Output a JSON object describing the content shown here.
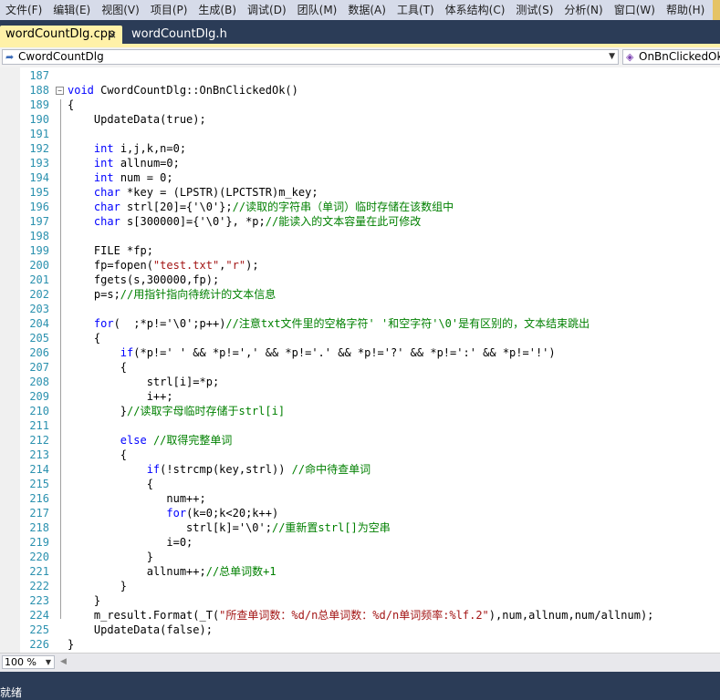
{
  "menu": [
    "文件(F)",
    "编辑(E)",
    "视图(V)",
    "项目(P)",
    "生成(B)",
    "调试(D)",
    "团队(M)",
    "数据(A)",
    "工具(T)",
    "体系结构(C)",
    "测试(S)",
    "分析(N)",
    "窗口(W)",
    "帮助(H)"
  ],
  "tabs": {
    "active": "wordCountDlg.cpp",
    "active_close": "×",
    "inactive": "wordCountDlg.h"
  },
  "nav": {
    "class_icon": "class-icon",
    "class_name": "CwordCountDlg",
    "member_name": "OnBnClickedOk"
  },
  "zoom": "100 %",
  "status": "就绪",
  "code_lines": [
    {
      "n": "187",
      "t": ""
    },
    {
      "n": "188",
      "t": "void CwordCountDlg::OnBnClickedOk()"
    },
    {
      "n": "189",
      "t": "{"
    },
    {
      "n": "190",
      "t": "    UpdateData(true);"
    },
    {
      "n": "191",
      "t": ""
    },
    {
      "n": "192",
      "t": "    int i,j,k,n=0;"
    },
    {
      "n": "193",
      "t": "    int allnum=0;"
    },
    {
      "n": "194",
      "t": "    int num = 0;"
    },
    {
      "n": "195",
      "t": "    char *key = (LPSTR)(LPCTSTR)m_key;"
    },
    {
      "n": "196",
      "t": "    char strl[20]={'\\0'};//读取的字符串（单词）临时存储在该数组中"
    },
    {
      "n": "197",
      "t": "    char s[300000]={'\\0'}, *p;//能读入的文本容量在此可修改"
    },
    {
      "n": "198",
      "t": ""
    },
    {
      "n": "199",
      "t": "    FILE *fp;"
    },
    {
      "n": "200",
      "t": "    fp=fopen(\"test.txt\",\"r\");"
    },
    {
      "n": "201",
      "t": "    fgets(s,300000,fp);"
    },
    {
      "n": "202",
      "t": "    p=s;//用指针指向待统计的文本信息"
    },
    {
      "n": "203",
      "t": ""
    },
    {
      "n": "204",
      "t": "    for(  ;*p!='\\0';p++)//注意txt文件里的空格字符' '和空字符'\\0'是有区别的，文本结束跳出"
    },
    {
      "n": "205",
      "t": "    {"
    },
    {
      "n": "206",
      "t": "        if(*p!=' ' && *p!=',' && *p!='.' && *p!='?' && *p!=':' && *p!='!')"
    },
    {
      "n": "207",
      "t": "        {"
    },
    {
      "n": "208",
      "t": "            strl[i]=*p;"
    },
    {
      "n": "209",
      "t": "            i++;"
    },
    {
      "n": "210",
      "t": "        }//读取字母临时存储于strl[i]"
    },
    {
      "n": "211",
      "t": ""
    },
    {
      "n": "212",
      "t": "        else //取得完整单词"
    },
    {
      "n": "213",
      "t": "        {"
    },
    {
      "n": "214",
      "t": "            if(!strcmp(key,strl)) //命中待查单词"
    },
    {
      "n": "215",
      "t": "            {"
    },
    {
      "n": "216",
      "t": "               num++;"
    },
    {
      "n": "217",
      "t": "               for(k=0;k<20;k++)"
    },
    {
      "n": "218",
      "t": "                  strl[k]='\\0';//重新置strl[]为空串"
    },
    {
      "n": "219",
      "t": "               i=0;"
    },
    {
      "n": "220",
      "t": "            }"
    },
    {
      "n": "221",
      "t": "            allnum++;//总单词数+1"
    },
    {
      "n": "222",
      "t": "        }"
    },
    {
      "n": "223",
      "t": "    }"
    },
    {
      "n": "224",
      "t": "    m_result.Format(_T(\"所查单词数：%d/n总单词数：%d/n单词频率:%lf.2\"),num,allnum,num/allnum);"
    },
    {
      "n": "225",
      "t": "    UpdateData(false);"
    },
    {
      "n": "226",
      "t": "}"
    },
    {
      "n": "227",
      "t": ""
    }
  ]
}
